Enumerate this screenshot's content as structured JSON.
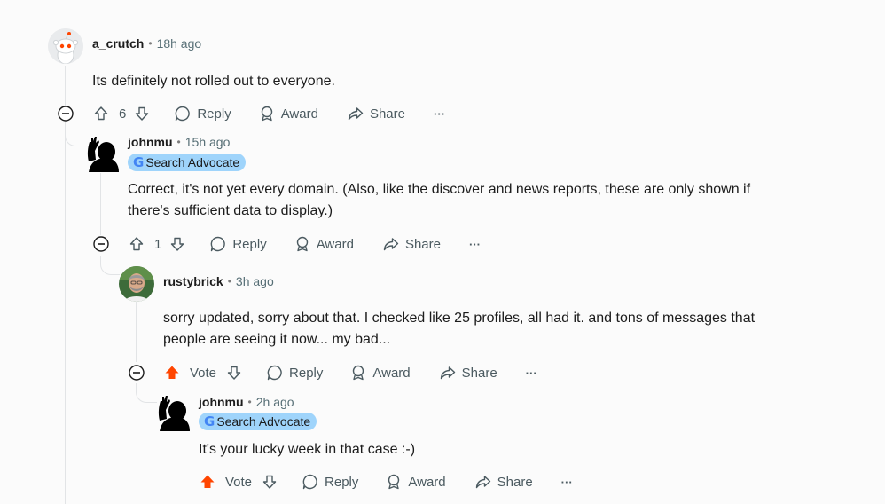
{
  "comments": [
    {
      "username": "a_crutch",
      "time": "18h ago",
      "body": "Its definitely not rolled out to everyone.",
      "score": "6",
      "vote_state": "neutral"
    },
    {
      "username": "johnmu",
      "time": "15h ago",
      "flair": "Search Advocate",
      "body_line1": "Correct, it's not yet every domain. (Also, like the discover and news reports, these are only shown if",
      "body_line2": "there's sufficient data to display.)",
      "score": "1",
      "vote_state": "neutral"
    },
    {
      "username": "rustybrick",
      "time": "3h ago",
      "body_line1": "sorry updated, sorry about that. I checked like 25 profiles, all had it. and tons of messages that",
      "body_line2": "people are seeing it now... my bad...",
      "score": "Vote",
      "vote_state": "upvoted"
    },
    {
      "username": "johnmu",
      "time": "2h ago",
      "flair": "Search Advocate",
      "body": "It's your lucky week in that case :-)",
      "score": "Vote",
      "vote_state": "upvoted"
    }
  ],
  "actions": {
    "reply": "Reply",
    "award": "Award",
    "share": "Share",
    "more": "···"
  },
  "separator": "•",
  "flair_icon": "G",
  "colors": {
    "upvoted": "#ff4500",
    "flair_bg": "#9fd4fb",
    "thread_line": "#e2e4e6"
  }
}
